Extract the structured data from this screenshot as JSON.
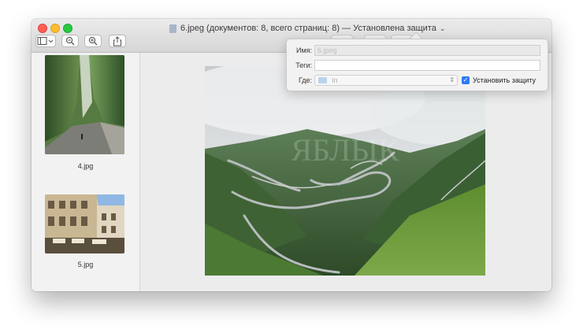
{
  "window": {
    "title": "6.jpeg (документов: 8, всего страниц: 8) — Установлена защита",
    "title_icon": "jpeg-document-icon",
    "title_chevron": "⌄"
  },
  "toolbar": {
    "buttons": [
      {
        "name": "sidebar-toggle",
        "icon": "sidebar-icon"
      },
      {
        "name": "zoom-out",
        "icon": "zoom-out-icon"
      },
      {
        "name": "zoom-in",
        "icon": "zoom-in-icon"
      },
      {
        "name": "share",
        "icon": "share-icon"
      }
    ]
  },
  "sidebar": {
    "items": [
      {
        "label": "4.jpg",
        "image": "mountain-road-photo"
      },
      {
        "label": "5.jpg",
        "image": "arcade-courtyard-photo"
      }
    ]
  },
  "main": {
    "image": "serpentine-mountain-road-photo",
    "watermark": "ЯБЛЫК"
  },
  "popover": {
    "name_label": "Имя:",
    "name_value": "6.jpeg",
    "tags_label": "Теги:",
    "tags_value": "",
    "where_label": "Где:",
    "where_value": "In",
    "protect_label": "Установить защиту",
    "protect_checked": true,
    "checkmark": "✓"
  },
  "colors": {
    "accent": "#2f7bf6",
    "close": "#fd5f57",
    "minimize": "#febc2e",
    "zoom": "#28c840"
  }
}
